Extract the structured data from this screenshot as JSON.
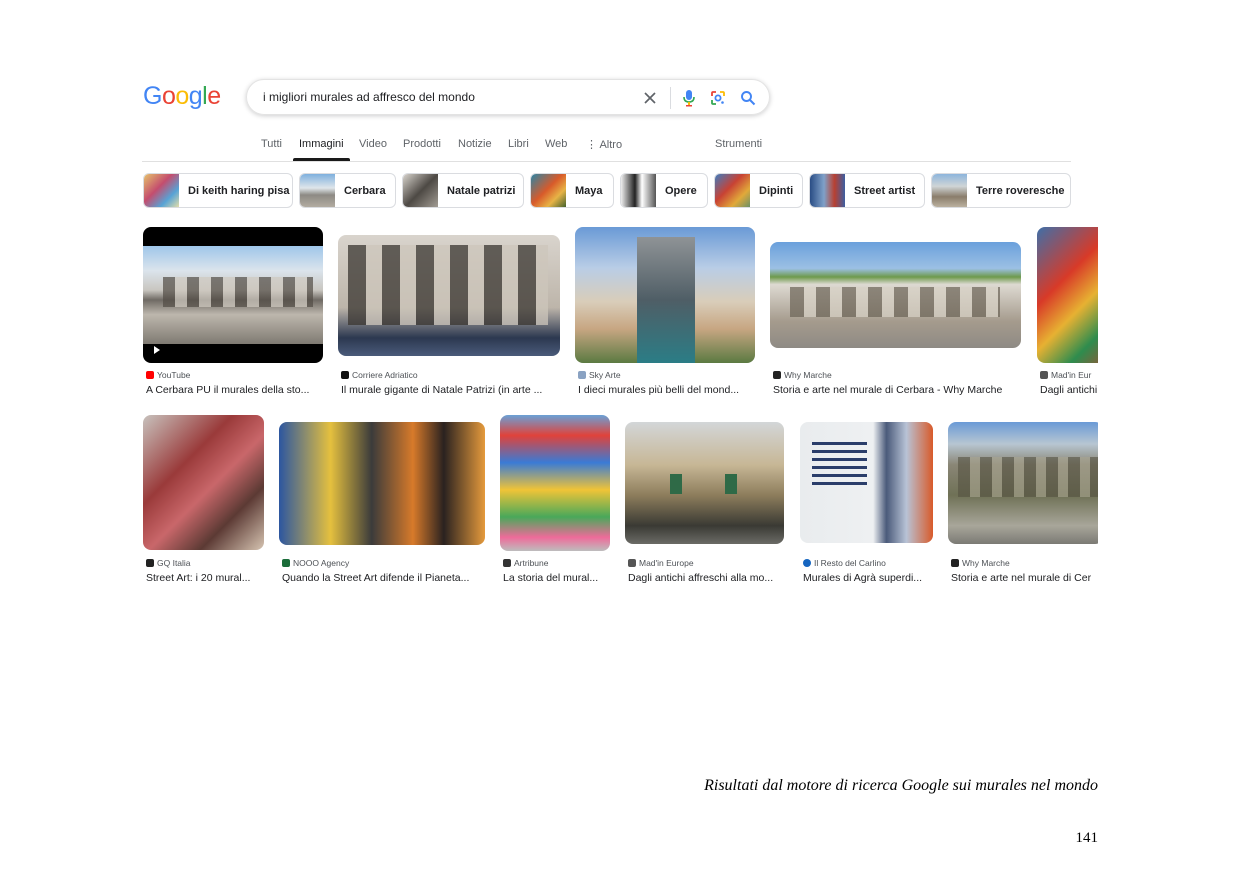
{
  "logo": {
    "letters": [
      "G",
      "o",
      "o",
      "g",
      "l",
      "e"
    ],
    "colors": [
      "#4285f4",
      "#ea4335",
      "#fbbc05",
      "#4285f4",
      "#34a853",
      "#ea4335"
    ]
  },
  "search": {
    "query": "i migliori murales ad affresco del mondo"
  },
  "icons": {
    "clear": "close-icon",
    "mic": "microphone-icon",
    "lens": "google-lens-icon",
    "search": "search-icon"
  },
  "tabs": [
    "Tutti",
    "Immagini",
    "Video",
    "Prodotti",
    "Notizie",
    "Libri",
    "Web",
    "⋮ Altro",
    "Strumenti"
  ],
  "active_tab": "Immagini",
  "chips": [
    "Di keith haring pisa",
    "Cerbara",
    "Natale patrizi",
    "Maya",
    "Opere",
    "Dipinti",
    "Street artist",
    "Terre roveresche"
  ],
  "results_row1": [
    {
      "source": "YouTube",
      "title": "A Cerbara PU il murales della sto..."
    },
    {
      "source": "Corriere Adriatico",
      "title": "Il murale gigante di Natale Patrizi (in arte ..."
    },
    {
      "source": "Sky Arte",
      "title": "I dieci murales più belli del mond..."
    },
    {
      "source": "Why Marche",
      "title": "Storia e arte nel murale di Cerbara - Why Marche"
    },
    {
      "source": "Mad'in Eur",
      "title": "Dagli antichi"
    }
  ],
  "results_row2": [
    {
      "source": "GQ Italia",
      "title": "Street Art: i 20 mural..."
    },
    {
      "source": "NOOO Agency",
      "title": "Quando la Street Art difende il Pianeta..."
    },
    {
      "source": "Artribune",
      "title": "La storia del mural..."
    },
    {
      "source": "Mad'in Europe",
      "title": "Dagli antichi affreschi alla mo..."
    },
    {
      "source": "Il Resto del Carlino",
      "title": "Murales di Agrà superdi..."
    },
    {
      "source": "Why Marche",
      "title": "Storia e arte nel murale di Cer"
    }
  ],
  "colors": {
    "favicon_youtube": "#ff0000",
    "favicon_resto": "#1565c0",
    "accent_blue": "#4285f4"
  },
  "caption": "Risultati dal motore di ricerca Google sui murales nel mondo",
  "page_number": "141"
}
